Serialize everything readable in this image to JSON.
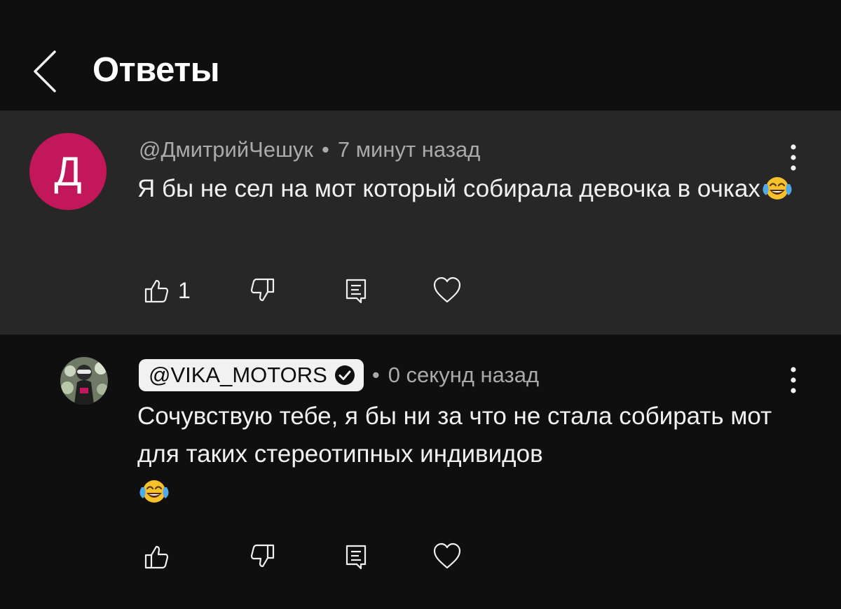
{
  "header": {
    "title": "Ответы",
    "back_icon": "chevron-left-icon"
  },
  "colors": {
    "background": "#0f0f0f",
    "highlight": "#272727",
    "avatar_letter_bg": "#c2185b",
    "text_primary": "#f1f1f1",
    "text_secondary": "#aaaaaa"
  },
  "comments": [
    {
      "avatar_letter": "Д",
      "author": "@ДмитрийЧешук",
      "separator": "•",
      "time": "7 минут назад",
      "text": "Я бы не сел на мот который собирала девочка в очках",
      "emoji": "😂",
      "like_count": "1",
      "icons": [
        "thumbs-up-icon",
        "thumbs-down-icon",
        "reply-icon",
        "heart-icon",
        "more-vertical-icon"
      ]
    },
    {
      "author": "@VIKA_MOTORS",
      "verified": true,
      "separator": "•",
      "time": "0 секунд назад",
      "text": "Сочувствую тебе, я бы ни за что не стала собирать мот для таких стереотипных индивидов",
      "emoji": "😂",
      "like_count": "",
      "icons": [
        "thumbs-up-icon",
        "thumbs-down-icon",
        "reply-icon",
        "heart-icon",
        "more-vertical-icon"
      ]
    }
  ]
}
